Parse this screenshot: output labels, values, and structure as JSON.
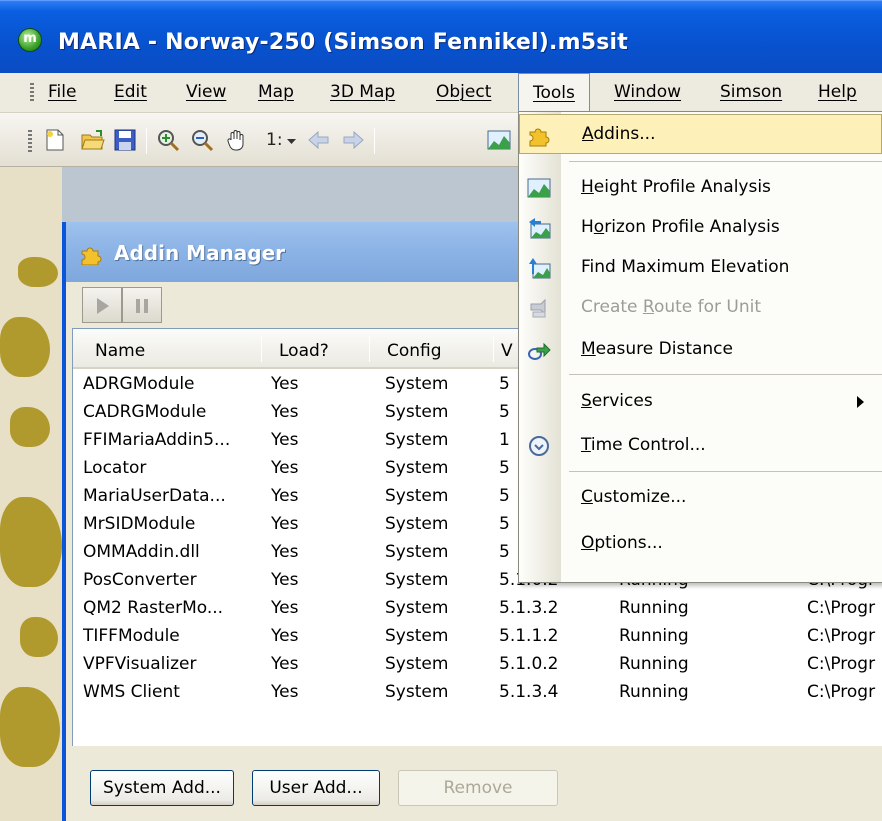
{
  "window": {
    "app_icon_letter": "m",
    "title": "MARIA - Norway-250 (Simson Fennikel).m5sit"
  },
  "menubar": {
    "items": [
      {
        "label": "File"
      },
      {
        "label": "Edit"
      },
      {
        "label": "View"
      },
      {
        "label": "Map"
      },
      {
        "label": "3D Map"
      },
      {
        "label": "Object"
      },
      {
        "label": "Tools"
      },
      {
        "label": "Window"
      },
      {
        "label": "Simson"
      },
      {
        "label": "Help"
      }
    ]
  },
  "toolbar": {
    "scale_label": "1:",
    "icons": [
      "new-document-icon",
      "open-folder-icon",
      "save-icon",
      "zoom-in-icon",
      "zoom-out-icon",
      "pan-hand-icon",
      "scale-dropdown-icon",
      "back-arrow-icon",
      "forward-arrow-icon",
      "height-profile-icon"
    ]
  },
  "addin_manager": {
    "title": "Addin Manager",
    "columns": [
      "Name",
      "Load?",
      "Config",
      "V"
    ],
    "rows": [
      {
        "name": "ADRGModule",
        "load": "Yes",
        "config": "System",
        "version": "5",
        "status": "",
        "path": ""
      },
      {
        "name": "CADRGModule",
        "load": "Yes",
        "config": "System",
        "version": "5",
        "status": "",
        "path": ""
      },
      {
        "name": "FFIMariaAddin5...",
        "load": "Yes",
        "config": "System",
        "version": "1",
        "status": "",
        "path": ""
      },
      {
        "name": "Locator",
        "load": "Yes",
        "config": "System",
        "version": "5",
        "status": "",
        "path": ""
      },
      {
        "name": "MariaUserData...",
        "load": "Yes",
        "config": "System",
        "version": "5",
        "status": "",
        "path": ""
      },
      {
        "name": "MrSIDModule",
        "load": "Yes",
        "config": "System",
        "version": "5",
        "status": "",
        "path": ""
      },
      {
        "name": "OMMAddin.dll",
        "load": "Yes",
        "config": "System",
        "version": "5",
        "status": "",
        "path": ""
      },
      {
        "name": "PosConverter",
        "load": "Yes",
        "config": "System",
        "version": "5.1.0.2",
        "status": "Running",
        "path": "C:\\Progr"
      },
      {
        "name": "QM2 RasterMo...",
        "load": "Yes",
        "config": "System",
        "version": "5.1.3.2",
        "status": "Running",
        "path": "C:\\Progr"
      },
      {
        "name": "TIFFModule",
        "load": "Yes",
        "config": "System",
        "version": "5.1.1.2",
        "status": "Running",
        "path": "C:\\Progr"
      },
      {
        "name": "VPFVisualizer",
        "load": "Yes",
        "config": "System",
        "version": "5.1.0.2",
        "status": "Running",
        "path": "C:\\Progr"
      },
      {
        "name": "WMS Client",
        "load": "Yes",
        "config": "System",
        "version": "5.1.3.4",
        "status": "Running",
        "path": "C:\\Progr"
      }
    ],
    "buttons": {
      "system_add": "System Add...",
      "user_add": "User Add...",
      "remove": "Remove"
    }
  },
  "tools_menu": {
    "items": [
      {
        "label": "Addins...",
        "icon": "puzzle-icon"
      },
      {
        "label": "Height Profile Analysis",
        "icon": "height-profile-icon"
      },
      {
        "label": "Horizon Profile Analysis",
        "icon": "horizon-profile-icon"
      },
      {
        "label": "Find Maximum Elevation",
        "icon": "max-elevation-icon"
      },
      {
        "label": "Create Route for Unit",
        "icon": "route-icon"
      },
      {
        "label": "Measure Distance",
        "icon": "measure-distance-icon"
      },
      {
        "label": "Services",
        "icon": ""
      },
      {
        "label": "Time Control...",
        "icon": "clock-icon"
      },
      {
        "label": "Customize...",
        "icon": ""
      },
      {
        "label": "Options...",
        "icon": ""
      }
    ]
  },
  "colors": {
    "title_bar": "#0a55d8",
    "dialog_title": "#8db4e6",
    "menu_highlight": "#fdf0b8",
    "window_face": "#ece9d8"
  }
}
